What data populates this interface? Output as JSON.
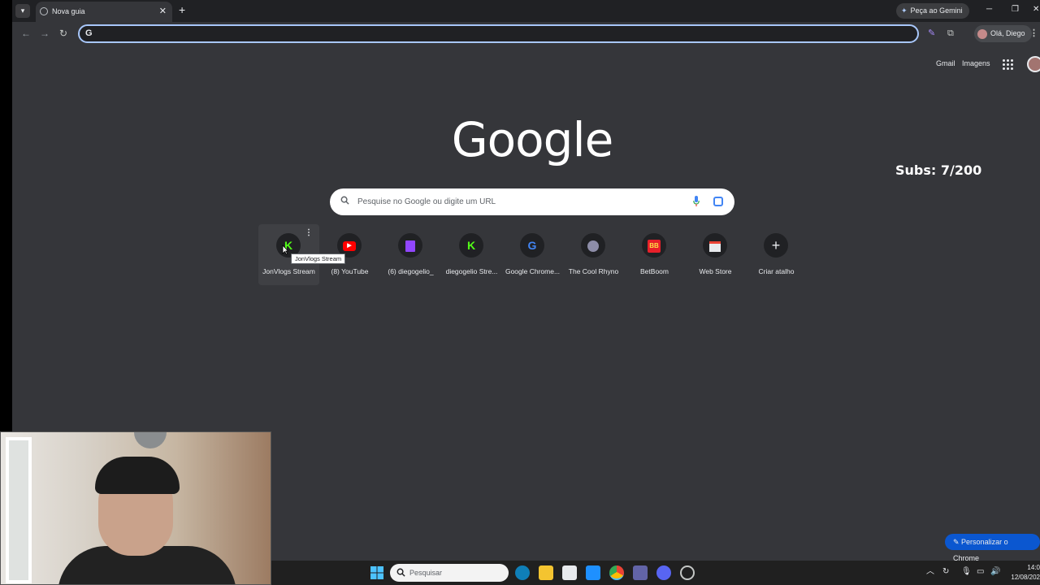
{
  "browser": {
    "tab_title": "Nova guia",
    "gemini_label": "Peça ao Gemini",
    "profile_label": "Olá, Diego",
    "omnibox_value": ""
  },
  "page": {
    "top_links": {
      "gmail": "Gmail",
      "images": "Imagens"
    },
    "logo": "Google",
    "search_placeholder": "Pesquise no Google ou digite um URL",
    "shortcuts": [
      {
        "label": "JonVlogs Stream",
        "icon": "K",
        "color": "#53fc18"
      },
      {
        "label": "(8) YouTube",
        "icon": "▶",
        "color": "#ff0000"
      },
      {
        "label": "(6) diegogelio_",
        "icon": "twitch",
        "color": "#9146ff"
      },
      {
        "label": "diegogelio Stre...",
        "icon": "K",
        "color": "#53fc18"
      },
      {
        "label": "Google Chrome...",
        "icon": "G",
        "color": "#4285f4"
      },
      {
        "label": "The Cool Rhyno",
        "icon": "rhyno",
        "color": "#b0b0c8"
      },
      {
        "label": "BetBoom",
        "icon": "BB",
        "color": "#e8202a"
      },
      {
        "label": "Web Store",
        "icon": "store",
        "color": "#e8eaed"
      },
      {
        "label": "Criar atalho",
        "icon": "+",
        "color": "#e8eaed"
      }
    ],
    "tooltip": "JonVlogs Stream",
    "customize_label": "Personalizar o Chrome"
  },
  "overlay": {
    "subs_text": "Subs: 7/200"
  },
  "taskbar": {
    "search_placeholder": "Pesquisar",
    "time": "14:0",
    "date": "12/08/202"
  }
}
